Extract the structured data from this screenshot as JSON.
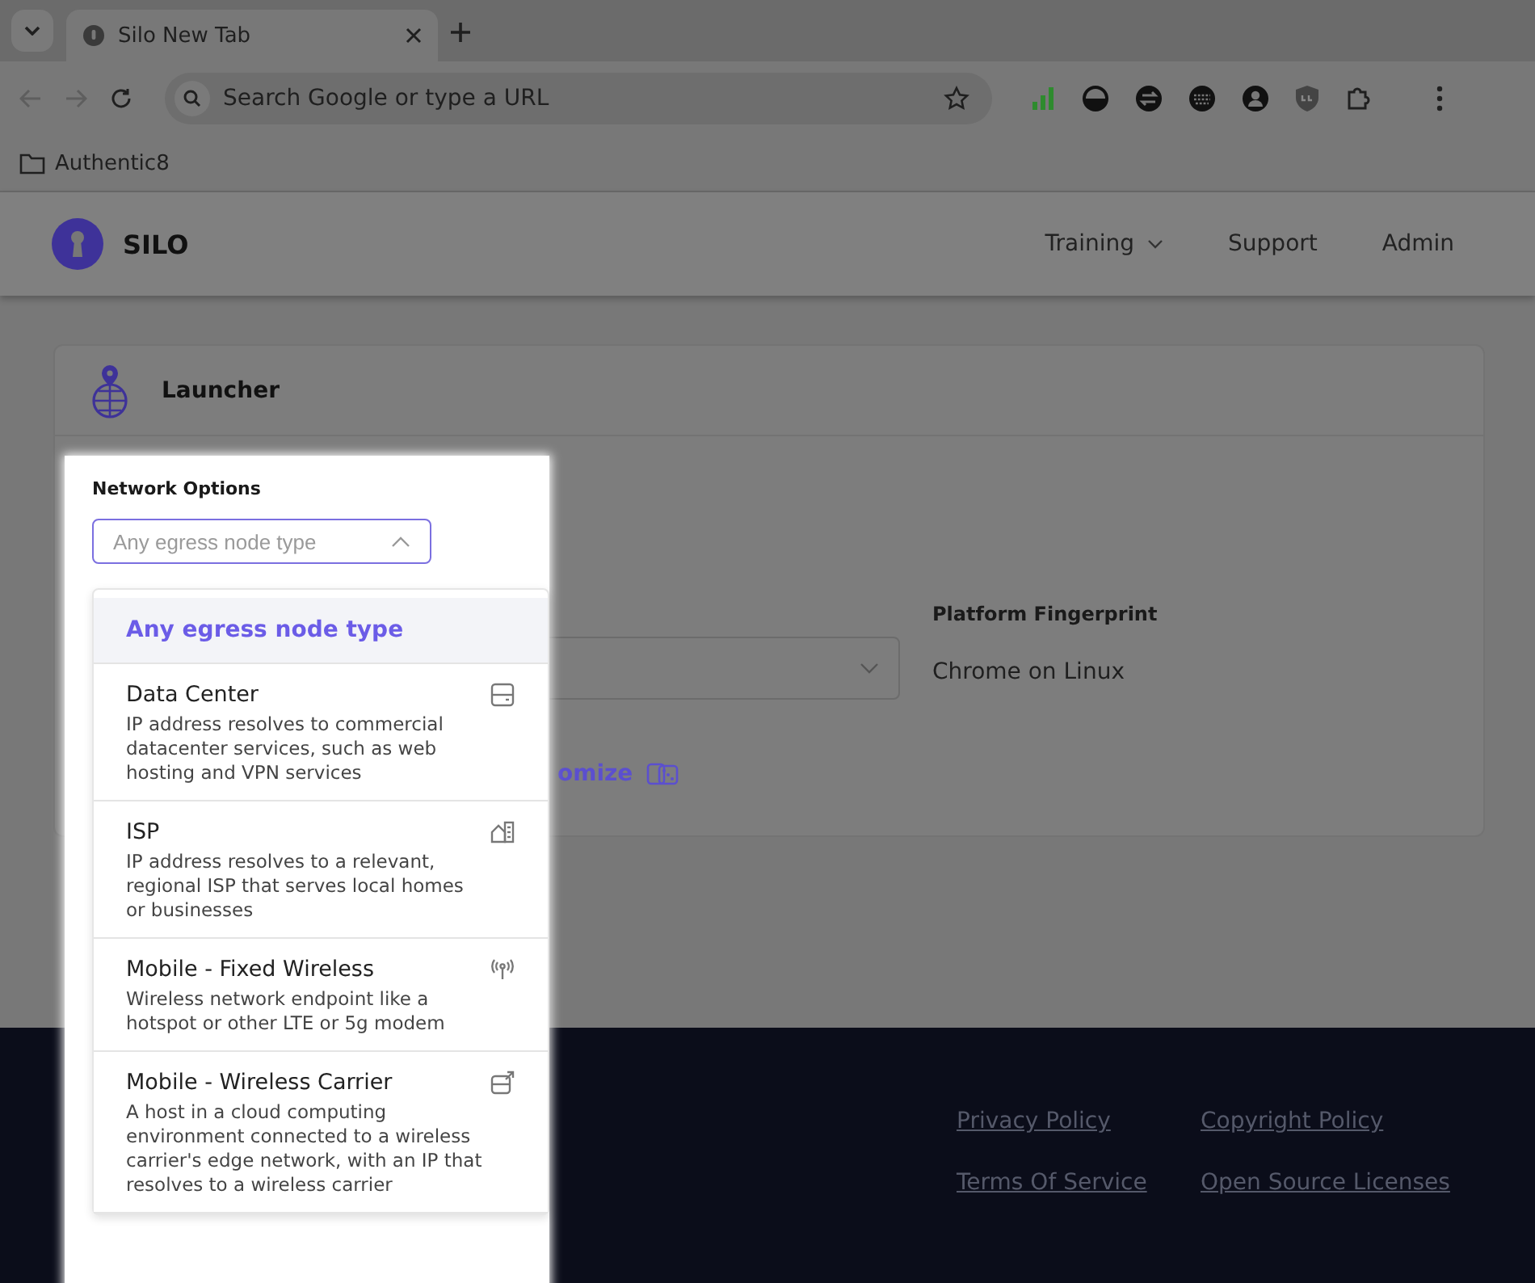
{
  "browser": {
    "tab_title": "Silo New Tab",
    "address_placeholder": "Search Google or type a URL",
    "bookmarks": [
      "Authentic8"
    ]
  },
  "header": {
    "brand": "SILO",
    "nav": [
      {
        "label": "Training",
        "has_menu": true
      },
      {
        "label": "Support",
        "has_menu": false
      },
      {
        "label": "Admin",
        "has_menu": false
      }
    ]
  },
  "launcher": {
    "title": "Launcher",
    "platform_label": "Platform Fingerprint",
    "platform_value": "Chrome on Linux",
    "randomize_link": "omize"
  },
  "network": {
    "label": "Network Options",
    "placeholder": "Any egress node type",
    "expanded": true,
    "options": [
      {
        "kind": "any",
        "title": "Any egress node type",
        "selected": true
      },
      {
        "kind": "datacenter",
        "title": "Data Center",
        "description": "IP address resolves to commercial datacenter services, such as web hosting and VPN services",
        "selected": false
      },
      {
        "kind": "isp",
        "title": "ISP",
        "description": "IP address resolves to a relevant, regional ISP that serves local homes or businesses",
        "selected": false
      },
      {
        "kind": "fixed",
        "title": "Mobile - Fixed Wireless",
        "description": "Wireless network endpoint like a hotspot or other LTE or 5g modem",
        "selected": false
      },
      {
        "kind": "carrier",
        "title": "Mobile - Wireless Carrier",
        "description": "A host in a cloud computing environment connected to a wireless carrier's edge network, with an IP that resolves to a wireless carrier",
        "selected": false
      }
    ]
  },
  "footer": {
    "links": [
      "Privacy Policy",
      "Copyright Policy",
      "Terms Of Service",
      "Open Source Licenses"
    ]
  }
}
